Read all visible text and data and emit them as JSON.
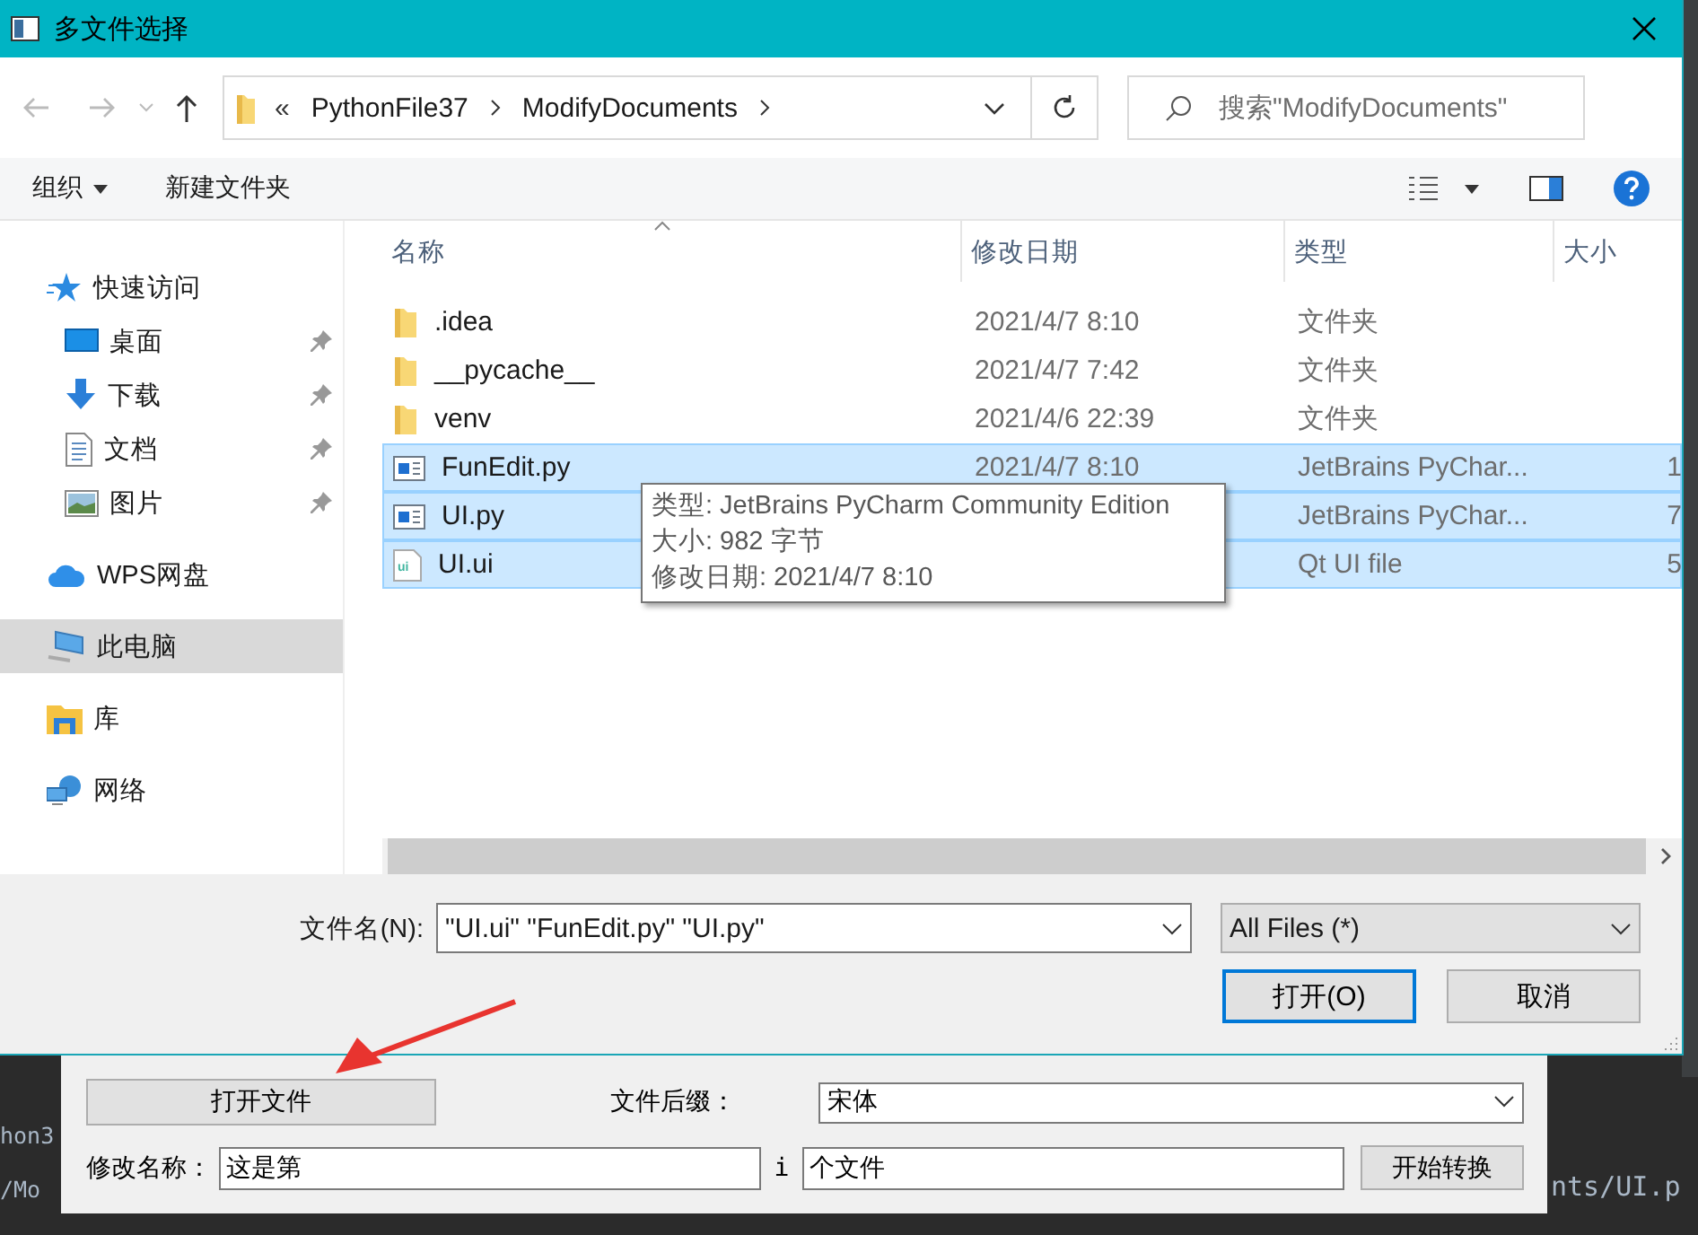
{
  "terminal": {
    "lines": [
      "hon3",
      "/Mo"
    ],
    "right_text": "nts/UI.p"
  },
  "app_window": {
    "open_button": "打开文件",
    "suffix_label": "文件后缀：",
    "suffix_value": "宋体",
    "rename_label": "修改名称：",
    "rename_value": "这是第",
    "separator": "i",
    "suffix2_value": "个文件",
    "start_button": "开始转换"
  },
  "dialog": {
    "title": "多文件选择",
    "address": {
      "overflow": "«",
      "breadcrumb": [
        "PythonFile37",
        "ModifyDocuments"
      ]
    },
    "search": {
      "placeholder": "搜索\"ModifyDocuments\""
    },
    "toolbar": {
      "organize": "组织",
      "new_folder": "新建文件夹"
    },
    "sidebar": {
      "items": [
        {
          "label": "快速访问",
          "kind": "star",
          "selected": false,
          "children": [
            {
              "label": "桌面",
              "kind": "desktop",
              "pinned": true,
              "selected": false
            },
            {
              "label": "下载",
              "kind": "download",
              "pinned": true,
              "selected": false
            },
            {
              "label": "文档",
              "kind": "document",
              "pinned": true,
              "selected": false
            },
            {
              "label": "图片",
              "kind": "picture",
              "pinned": true,
              "selected": false
            }
          ]
        },
        {
          "label": "WPS网盘",
          "kind": "cloud",
          "selected": false
        },
        {
          "label": "此电脑",
          "kind": "computer",
          "selected": true
        },
        {
          "label": "库",
          "kind": "library",
          "selected": false
        },
        {
          "label": "网络",
          "kind": "network",
          "selected": false
        }
      ]
    },
    "columns": [
      "名称",
      "修改日期",
      "类型",
      "大小"
    ],
    "rows": [
      {
        "kind": "folder",
        "name": ".idea",
        "date": "2021/4/7 8:10",
        "type": "文件夹",
        "size": "",
        "selected": false
      },
      {
        "kind": "folder",
        "name": "__pycache__",
        "date": "2021/4/7 7:42",
        "type": "文件夹",
        "size": "",
        "selected": false
      },
      {
        "kind": "folder",
        "name": "venv",
        "date": "2021/4/6 22:39",
        "type": "文件夹",
        "size": "",
        "selected": false
      },
      {
        "kind": "python",
        "name": "FunEdit.py",
        "date": "2021/4/7 8:10",
        "type": "JetBrains PyChar...",
        "size": "1",
        "selected": true
      },
      {
        "kind": "python",
        "name": "UI.py",
        "date": "",
        "type": "JetBrains PyChar...",
        "size": "7",
        "selected": true
      },
      {
        "kind": "ui",
        "name": "UI.ui",
        "date": "",
        "type": "Qt UI file",
        "size": "5",
        "selected": true
      }
    ],
    "tooltip": {
      "lines": [
        "类型: JetBrains PyCharm Community Edition",
        "大小: 982 字节",
        "修改日期: 2021/4/7 8:10"
      ]
    },
    "filename_label": "文件名(N):",
    "filename_value": "\"UI.ui\" \"FunEdit.py\" \"UI.py\"",
    "filter": "All Files (*)",
    "buttons": [
      {
        "label": "打开(O)",
        "default": true
      },
      {
        "label": "取消",
        "default": false
      }
    ]
  }
}
